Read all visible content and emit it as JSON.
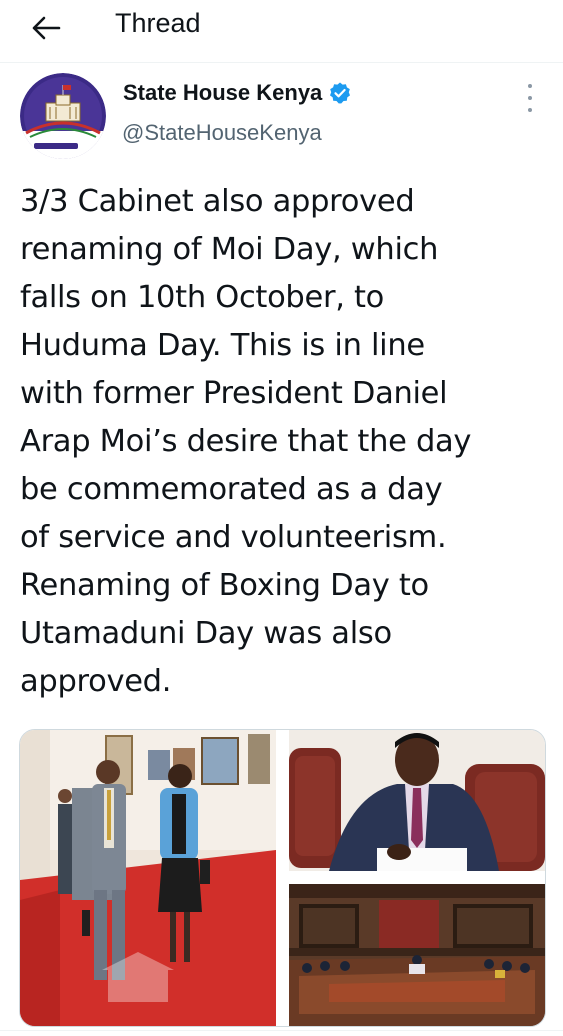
{
  "header": {
    "back_icon": "arrow-left-icon",
    "title": "Thread"
  },
  "tweet": {
    "author": {
      "display_name": "State House Kenya",
      "handle": "@StateHouseKenya",
      "verified": true,
      "avatar_icon": "state-house-logo"
    },
    "more_icon": "more-vertical-icon",
    "text": "3/3 Cabinet also approved\nrenaming of Moi Day, which\nfalls on 10th October, to\nHuduma Day. This is in line\nwith former President Daniel\nArap Moi’s desire that the day\nbe commemorated as a day\nof service and volunteerism.\nRenaming of Boxing Day to\nUtamaduni Day was also\napproved.",
    "media": [
      {
        "name": "photo-officials-walking-red-carpet"
      },
      {
        "name": "photo-man-signing-document"
      },
      {
        "name": "photo-cabinet-meeting-room"
      }
    ]
  },
  "colors": {
    "text": "#0f1419",
    "secondary": "#536471",
    "verified": "#1d9bf0",
    "carpet": "#c8302c"
  }
}
